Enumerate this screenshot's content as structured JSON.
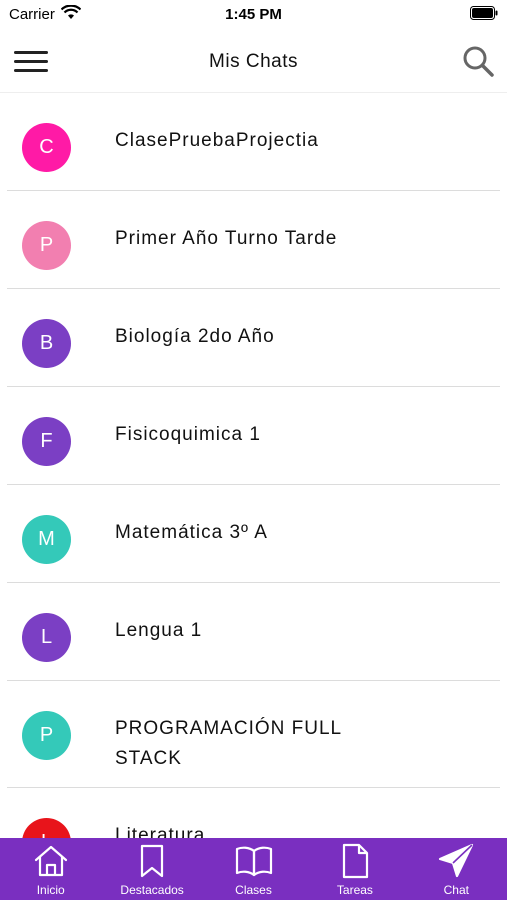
{
  "status_bar": {
    "carrier": "Carrier",
    "time": "1:45 PM"
  },
  "header": {
    "title": "Mis Chats"
  },
  "chats": [
    {
      "initial": "C",
      "name": "ClasePruebaProjectia",
      "color": "#ff1aa6"
    },
    {
      "initial": "P",
      "name": "Primer Año Turno Tarde",
      "color": "#f27fb0"
    },
    {
      "initial": "B",
      "name": "Biología 2do Año",
      "color": "#7b3fc4"
    },
    {
      "initial": "F",
      "name": "Fisicoquimica 1",
      "color": "#7b3fc4"
    },
    {
      "initial": "M",
      "name": "Matemática 3º A",
      "color": "#34c9b9"
    },
    {
      "initial": "L",
      "name": "Lengua 1",
      "color": "#7b3fc4"
    },
    {
      "initial": "P",
      "name": "PROGRAMACIÓN FULL STACK",
      "color": "#34c9b9"
    },
    {
      "initial": "L",
      "name": "Literatura",
      "color": "#e8141b"
    }
  ],
  "tabs": [
    {
      "label": "Inicio",
      "icon": "home-icon"
    },
    {
      "label": "Destacados",
      "icon": "bookmark-icon"
    },
    {
      "label": "Clases",
      "icon": "book-icon"
    },
    {
      "label": "Tareas",
      "icon": "document-icon"
    },
    {
      "label": "Chat",
      "icon": "send-icon"
    }
  ],
  "colors": {
    "tab_bar": "#7a2fc0"
  }
}
